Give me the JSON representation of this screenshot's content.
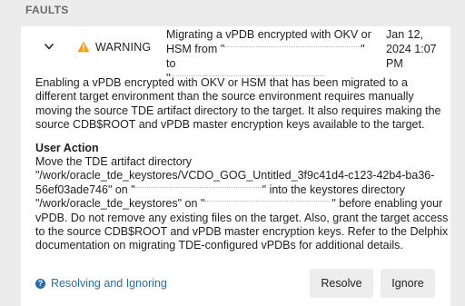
{
  "section": {
    "title": "FAULTS"
  },
  "fault": {
    "severity": "WARNING",
    "title_line1": "Migrating a vPDB encrypted with OKV or",
    "title_line2_a": "HSM from \"",
    "title_line2_b": "\" to",
    "title_line3": "\"",
    "date_line1": "Jan 12,",
    "date_line2": "2024 1:07",
    "date_line3": "PM",
    "description": "Enabling a vPDB encrypted with OKV or HSM that has been migrated to a different target environment than the source environment requires manually moving the source TDE artifact directory to the target. It also requires making the source CDB$ROOT and vPDB master encryption keys available to the target.",
    "user_action_heading": "User Action",
    "action_line1": "Move the TDE artifact directory",
    "action_path1": "\"/work/oracle_tde_keystores/VCDO_GOG_Untitled_3f9c41d4-c123-42b4-ba36-56ef03ade746\" on \"",
    "action_into": "\" into the keystores directory",
    "action_path2": "\"/work/oracle_tde_keystores\" on \"",
    "action_before": "\" before enabling your vPDB. Do not remove any existing files on the target. Also, grant the target access to the source CDB$ROOT and vPDB master encryption keys. Refer to the Delphix documentation on migrating TDE-configured vPDBs for additional details."
  },
  "footer": {
    "help_link": "Resolving and Ignoring",
    "resolve_button": "Resolve",
    "ignore_button": "Ignore"
  },
  "colors": {
    "warning": "#f0a020",
    "link": "#1f6fb5"
  },
  "icons": {
    "expand": "chevron-down-icon",
    "severity": "warning-triangle-icon",
    "help": "question-circle-icon"
  }
}
